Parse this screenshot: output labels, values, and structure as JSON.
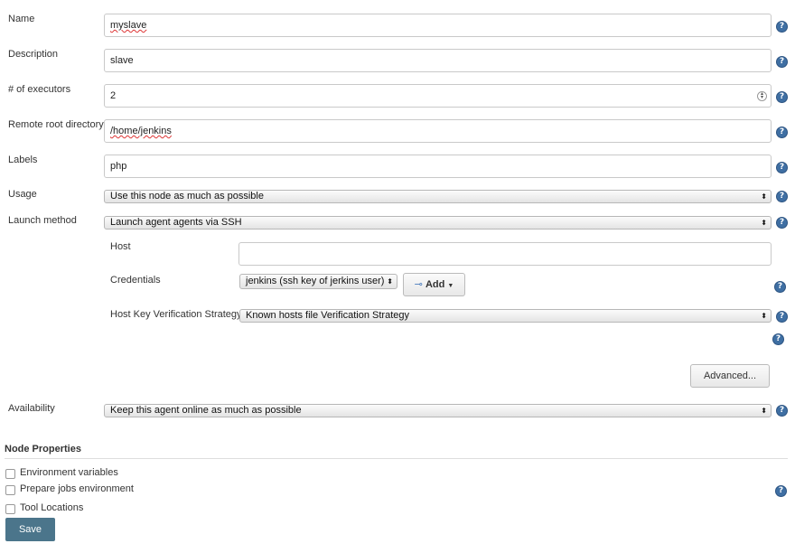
{
  "fields": {
    "name": {
      "label": "Name",
      "value": "myslave"
    },
    "description": {
      "label": "Description",
      "value": "slave"
    },
    "executors": {
      "label": "# of executors",
      "value": "2"
    },
    "remote_root": {
      "label": "Remote root directory",
      "value": "/home/jenkins"
    },
    "labels": {
      "label": "Labels",
      "value": "php"
    },
    "usage": {
      "label": "Usage",
      "value": "Use this node as much as possible"
    },
    "launch_method": {
      "label": "Launch method",
      "value": "Launch agent agents via SSH"
    },
    "availability": {
      "label": "Availability",
      "value": "Keep this agent online as much as possible"
    }
  },
  "ssh": {
    "host_label": "Host",
    "host_value": "",
    "credentials_label": "Credentials",
    "credentials_value": "jenkins (ssh key of jerkins user)",
    "add_label": "Add",
    "host_key_label": "Host Key Verification Strategy",
    "host_key_value": "Known hosts file Verification Strategy",
    "advanced_label": "Advanced..."
  },
  "node_properties": {
    "heading": "Node Properties",
    "items": [
      {
        "label": "Environment variables",
        "checked": false
      },
      {
        "label": "Prepare jobs environment",
        "checked": false
      },
      {
        "label": "Tool Locations",
        "checked": false
      }
    ]
  },
  "save_label": "Save",
  "icons": {
    "help": "help-icon",
    "key": "key-icon",
    "dropdown": "dropdown-arrows-icon"
  }
}
